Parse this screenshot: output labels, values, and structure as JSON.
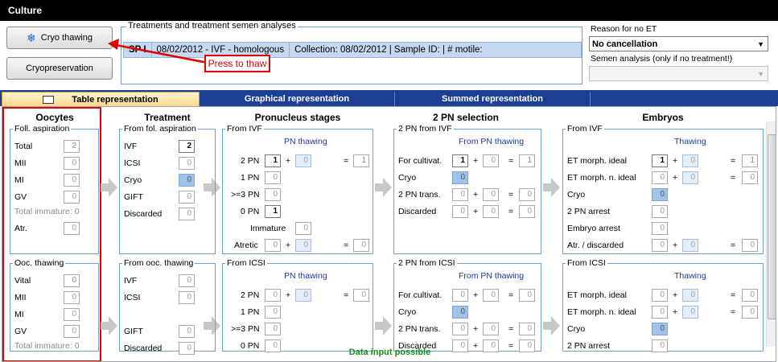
{
  "window": {
    "title": "Culture"
  },
  "buttons": {
    "cryo_thawing": "Cryo thawing",
    "cryopreservation": "Cryopreservation"
  },
  "callout": "Press to thaw",
  "treatments": {
    "legend": "Treatments and treatment semen analyses",
    "row": {
      "code": "SP I",
      "date_type": "08/02/2012 - IVF - homologous",
      "collection": "Collection: 08/02/2012 | Sample ID:  | # motile:"
    }
  },
  "reason": {
    "label": "Reason for no ET",
    "value": "No cancellation"
  },
  "semen": {
    "label": "Semen analysis (only if no treatment!)",
    "value": ""
  },
  "tabs": [
    "Table representation",
    "Graphical representation",
    "Summed representation"
  ],
  "sections": {
    "oocytes": "Oocytes",
    "treatment": "Treatment",
    "pronucleus": "Pronucleus stages",
    "pn_selection": "2 PN selection",
    "embryos": "Embryos"
  },
  "oocytes": {
    "top": {
      "legend": "Foll. aspiration",
      "rows": [
        [
          "Total",
          "2"
        ],
        [
          "MII",
          "0"
        ],
        [
          "MI",
          "0"
        ],
        [
          "GV",
          "0"
        ]
      ],
      "total_immature": "Total immature: 0",
      "atr_label": "Atr.",
      "atr_value": "0"
    },
    "bottom": {
      "legend": "Ooc. thawing",
      "rows": [
        [
          "Vital",
          "0"
        ],
        [
          "MII",
          "0"
        ],
        [
          "MI",
          "0"
        ],
        [
          "GV",
          "0"
        ]
      ],
      "total_immature": "Total immature: 0"
    }
  },
  "treatment": {
    "top": {
      "legend": "From fol. aspiration",
      "rows": [
        [
          "IVF",
          "2"
        ],
        [
          "ICSI",
          "0"
        ],
        [
          "Cryo",
          "0"
        ],
        [
          "GIFT",
          "0"
        ],
        [
          "Discarded",
          "0"
        ]
      ]
    },
    "bottom": {
      "legend": "From ooc. thawing",
      "rows": [
        [
          "IVF",
          "0"
        ],
        [
          "ICSI",
          "0"
        ],
        [
          "GIFT",
          "0"
        ],
        [
          "Discarded",
          "0"
        ]
      ]
    }
  },
  "pn": {
    "top": {
      "legend": "From IVF",
      "header": "PN thawing",
      "row2": [
        "2 PN",
        "1",
        "0",
        "1"
      ],
      "row1": [
        "1 PN",
        "0"
      ],
      "row3": [
        ">=3 PN",
        "0"
      ],
      "row0": [
        "0 PN",
        "1"
      ],
      "immature": [
        "Immature",
        "0"
      ],
      "atretic": [
        "Atretic",
        "0",
        "0",
        "0"
      ]
    },
    "bottom": {
      "legend": "From ICSI",
      "header": "PN thawing",
      "row2": [
        "2 PN",
        "0",
        "0",
        "0"
      ],
      "row1": [
        "1 PN",
        "0"
      ],
      "row3": [
        ">=3 PN",
        "0"
      ],
      "row0": [
        "0 PN",
        "0"
      ]
    }
  },
  "sel": {
    "top": {
      "legend": "2 PN from IVF",
      "header": "From PN thawing",
      "cult": [
        "For cultivat.",
        "1",
        "0",
        "1"
      ],
      "cryo": [
        "Cryo",
        "0"
      ],
      "trans": [
        "2 PN trans.",
        "0",
        "0",
        "0"
      ],
      "disc": [
        "Discarded",
        "0",
        "0",
        "0"
      ]
    },
    "bottom": {
      "legend": "2 PN from ICSI",
      "header": "From PN thawing",
      "cult": [
        "For cultivat.",
        "0",
        "0",
        "0"
      ],
      "cryo": [
        "Cryo",
        "0"
      ],
      "trans": [
        "2 PN trans.",
        "0",
        "0",
        "0"
      ],
      "disc": [
        "Discarded",
        "0",
        "0",
        "0"
      ]
    }
  },
  "emb": {
    "top": {
      "legend": "From IVF",
      "header": "Thawing",
      "ideal": [
        "ET morph. ideal",
        "1",
        "0",
        "1"
      ],
      "nideal": [
        "ET morph. n. ideal",
        "0",
        "0",
        "0"
      ],
      "cryo": [
        "Cryo",
        "0"
      ],
      "arrest2": [
        "2 PN arrest",
        "0"
      ],
      "arrest": [
        "Embryo arrest",
        "0"
      ],
      "atr": [
        "Atr. / discarded",
        "0",
        "0",
        "0"
      ]
    },
    "bottom": {
      "legend": "From ICSI",
      "header": "Thawing",
      "ideal": [
        "ET morph. ideal",
        "0",
        "0",
        "0"
      ],
      "nideal": [
        "ET morph. n. ideal",
        "0",
        "0",
        "0"
      ],
      "cryo": [
        "Cryo",
        "0"
      ],
      "arrest2": [
        "2 PN arrest",
        "0"
      ]
    }
  },
  "status": "Data input possible",
  "ops": {
    "plus": "+",
    "eq": "="
  }
}
